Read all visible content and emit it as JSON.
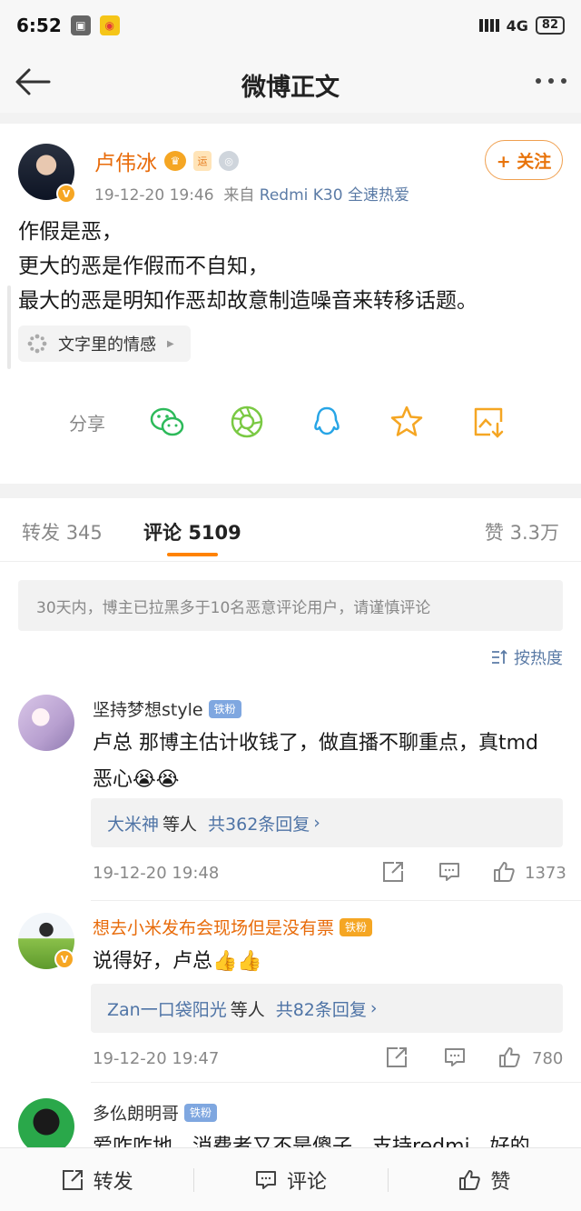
{
  "status_bar": {
    "time": "6:52",
    "network": "4G",
    "battery": "82"
  },
  "nav": {
    "title": "微博正文"
  },
  "post": {
    "author": "卢伟冰",
    "time": "19-12-20 19:46",
    "source_prefix": "来自",
    "source": "Redmi K30 全速热爱",
    "follow_label": "+ 关注",
    "lines": [
      "作假是恶，",
      "更大的恶是作假而不自知，",
      "最大的恶是明知作恶却故意制造噪音来转移话题。"
    ],
    "topic": "文字里的情感",
    "share_label": "分享"
  },
  "tabs": [
    {
      "label": "转发",
      "count": "345"
    },
    {
      "label": "评论",
      "count": "5109"
    },
    {
      "label": "赞",
      "count": "3.3万"
    }
  ],
  "notice": "30天内，博主已拉黑多于10名恶意评论用户，请谨慎评论",
  "sort_label": "按热度",
  "comments": [
    {
      "name": "坚持梦想style",
      "badge": "铁粉",
      "text": "卢总 那博主估计收钱了，做直播不聊重点，真tmd恶心😭😭",
      "reply_users": "大米神",
      "reply_mid": "等人",
      "reply_count": "共362条回复",
      "time": "19-12-20 19:48",
      "likes": "1373"
    },
    {
      "name": "想去小米发布会现场但是没有票",
      "badge": "铁粉",
      "text": "说得好，卢总👍👍",
      "reply_users": "Zan一口袋阳光",
      "reply_mid": "等人",
      "reply_count": "共82条回复",
      "time": "19-12-20 19:47",
      "likes": "780"
    },
    {
      "name": "多仫朗明哥",
      "badge": "铁粉",
      "text": "爱咋咋地，消费者又不是傻子，支持redmi，好的"
    }
  ],
  "bottom_bar": {
    "repost": "转发",
    "comment": "评论",
    "like": "赞"
  },
  "colors": {
    "accent": "#ff8200",
    "link": "#5b7ba6",
    "author": "#e86b0a"
  }
}
